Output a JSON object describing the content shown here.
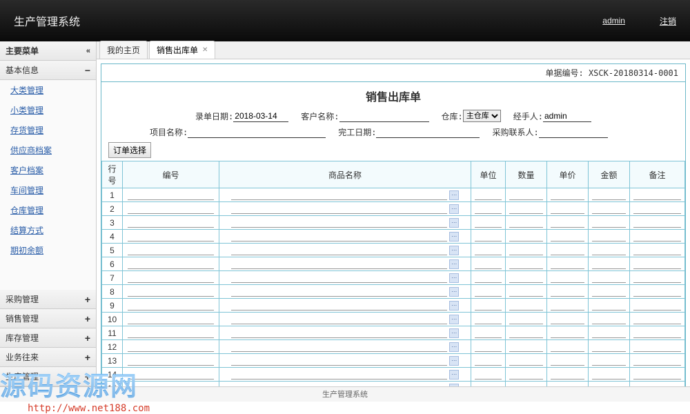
{
  "topbar": {
    "title": "生产管理系统",
    "user": "admin",
    "logout": "注销"
  },
  "sidebar": {
    "main_menu": "主要菜单",
    "groups": [
      {
        "label": "基本信息",
        "open": true,
        "sign": "−",
        "items": [
          "大类管理",
          "小类管理",
          "存货管理",
          "供应商档案",
          "客户档案",
          "车间管理",
          "仓库管理",
          "结算方式",
          "期初余额"
        ]
      },
      {
        "label": "采购管理",
        "open": false,
        "sign": "+"
      },
      {
        "label": "销售管理",
        "open": false,
        "sign": "+"
      },
      {
        "label": "库存管理",
        "open": false,
        "sign": "+"
      },
      {
        "label": "业务往来",
        "open": false,
        "sign": "+"
      },
      {
        "label": "生产管理",
        "open": false,
        "sign": "+"
      }
    ]
  },
  "tabs": [
    {
      "label": "我的主页",
      "closable": false
    },
    {
      "label": "销售出库单",
      "closable": true,
      "active": true
    }
  ],
  "doc": {
    "doc_no_label": "单据编号:",
    "doc_no": "XSCK-20180314-0001",
    "title": "销售出库单",
    "fields": {
      "entry_date_label": "录单日期:",
      "entry_date": "2018-03-14",
      "customer_label": "客户名称:",
      "customer": "",
      "warehouse_label": "仓库:",
      "warehouse_selected": "主仓库",
      "warehouse_options": [
        "主仓库"
      ],
      "handler_label": "经手人:",
      "handler": "admin",
      "project_label": "项目名称:",
      "project": "",
      "finish_date_label": "完工日期:",
      "finish_date": "",
      "contact_label": "采购联系人:",
      "contact": ""
    },
    "order_select_btn": "订单选择",
    "grid": {
      "headers": [
        "行号",
        "编号",
        "商品名称",
        "单位",
        "数量",
        "单价",
        "金额",
        "备注"
      ],
      "row_count": 15
    }
  },
  "footer": "生产管理系统",
  "watermark": {
    "text": "源码资源网",
    "url": "http://www.net188.com"
  }
}
